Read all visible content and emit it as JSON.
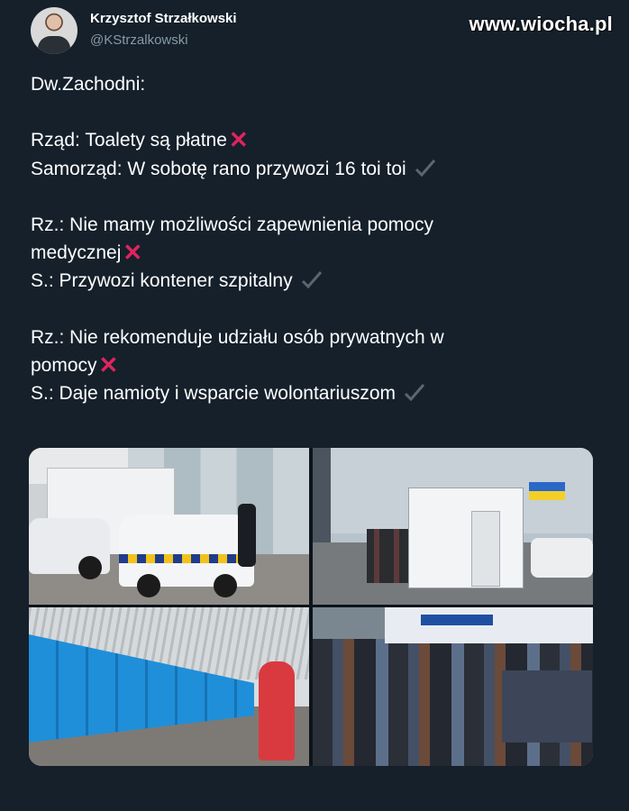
{
  "header": {
    "author_name": "Krzysztof Strzałkowski",
    "author_handle": "@KStrzalkowski",
    "watermark": "www.wiocha.pl"
  },
  "tweet": {
    "lines": [
      {
        "text": "Dw.Zachodni:",
        "mark": "none"
      },
      {
        "text": "",
        "mark": "none"
      },
      {
        "text": "Rząd: Toalety są płatne",
        "mark": "cross"
      },
      {
        "text": "Samorząd: W sobotę rano przywozi 16 toi toi",
        "mark": "check"
      },
      {
        "text": "",
        "mark": "none"
      },
      {
        "text": "Rz.: Nie mamy możliwości zapewnienia pomocy",
        "mark": "none"
      },
      {
        "text": "medycznej",
        "mark": "cross"
      },
      {
        "text": "S.: Przywozi kontener szpitalny",
        "mark": "check"
      },
      {
        "text": "",
        "mark": "none"
      },
      {
        "text": "Rz.: Nie rekomenduje udziału osób prywatnych w",
        "mark": "none"
      },
      {
        "text": "pomocy",
        "mark": "cross"
      },
      {
        "text": "S.: Daje namioty i wsparcie wolontariuszom",
        "mark": "check"
      }
    ]
  },
  "icons": {
    "cross": "cross-mark-icon",
    "check": "check-mark-icon"
  },
  "colors": {
    "background": "#15202b",
    "secondary_text": "#8899a6",
    "cross": "#e0245e",
    "check": "#5b6670"
  }
}
